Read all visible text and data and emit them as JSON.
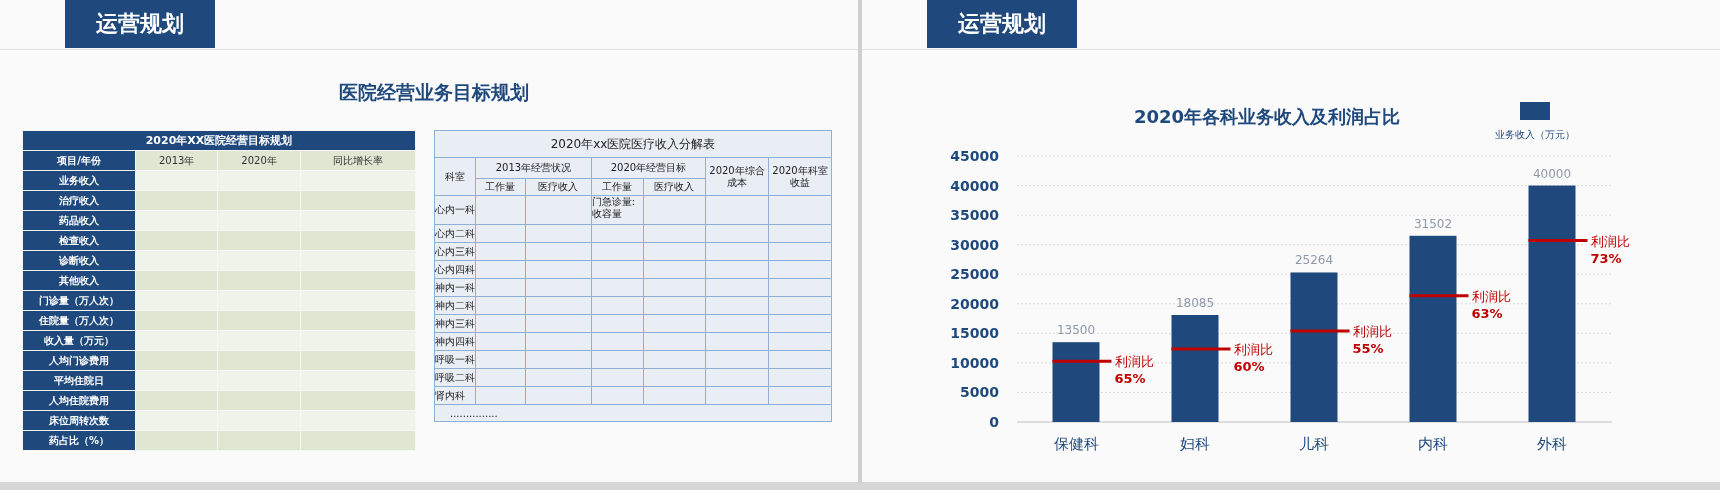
{
  "left_slide": {
    "header_tab": "运营规划",
    "heading": "医院经营业务目标规划",
    "plan_table": {
      "title": "2020年XX医院经营目标规划",
      "columns": [
        "项目/年份",
        "2013年",
        "2020年",
        "同比增长率"
      ],
      "rows": [
        "业务收入",
        "治疗收入",
        "药品收入",
        "检查收入",
        "诊断收入",
        "其他收入",
        "门诊量（万人次）",
        "住院量（万人次）",
        "收入量（万元）",
        "人均门诊费用",
        "平均住院日",
        "人均住院费用",
        "床位周转次数",
        "药占比（%）"
      ]
    },
    "breakdown_table": {
      "title": "2020年xx医院医疗收入分解表",
      "first_column": "科室",
      "groups": [
        {
          "label": "2013年经营状况",
          "columns": [
            "工作量",
            "医疗收入"
          ]
        },
        {
          "label": "2020年经营目标",
          "columns": [
            "工作量",
            "医疗收入"
          ]
        }
      ],
      "single_columns": [
        "2020年综合成本",
        "2020年科室收益"
      ],
      "rows": [
        {
          "department": "心内一科",
          "target_workload": "门急诊量:收容量"
        },
        {
          "department": "心内二科"
        },
        {
          "department": "心内三科"
        },
        {
          "department": "心内四科"
        },
        {
          "department": "神内一科"
        },
        {
          "department": "神内二科"
        },
        {
          "department": "神内三科"
        },
        {
          "department": "神内四科"
        },
        {
          "department": "呼吸一科"
        },
        {
          "department": "呼吸二科"
        },
        {
          "department": "肾内科"
        }
      ],
      "footer": "..............."
    }
  },
  "right_slide": {
    "header_tab": "运营规划",
    "chart": {
      "chart_data": {
        "type": "bar",
        "title": "2020年各科业务收入及利润占比",
        "categories": [
          "保健科",
          "妇科",
          "儿科",
          "内科",
          "外科"
        ],
        "series": [
          {
            "name": "业务收入（万元）",
            "color": "#1f497d",
            "values": [
              13500,
              18100,
              25300,
              31500,
              40000
            ]
          }
        ],
        "grid": true,
        "value_labels": [
          "13500",
          "18085",
          "25264",
          "31502",
          "40000"
        ],
        "ylim": [
          0,
          45000
        ],
        "yticks": [
          0,
          5000,
          10000,
          15000,
          20000,
          25000,
          30000,
          35000,
          40000,
          45000
        ],
        "annotations": [
          "利润比 65%",
          "利润比 60%",
          "利润比 55%",
          "利润比 63%",
          "利润比 73%"
        ]
      }
    }
  }
}
